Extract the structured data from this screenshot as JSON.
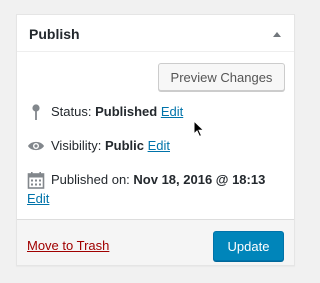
{
  "publish_box": {
    "title": "Publish",
    "preview_button": "Preview Changes",
    "status": {
      "label": "Status: ",
      "value": "Published",
      "edit": "Edit",
      "icon": "pin-icon"
    },
    "visibility": {
      "label": "Visibility: ",
      "value": "Public",
      "edit": "Edit",
      "icon": "eye-icon"
    },
    "published_on": {
      "label": "Published on: ",
      "value": "Nov 18, 2016 @ 18:13",
      "edit": "Edit",
      "icon": "calendar-icon"
    },
    "trash_link": "Move to Trash",
    "update_button": "Update"
  },
  "colors": {
    "link": "#0073aa",
    "trash": "#a00000",
    "primary_button": "#0085ba"
  }
}
